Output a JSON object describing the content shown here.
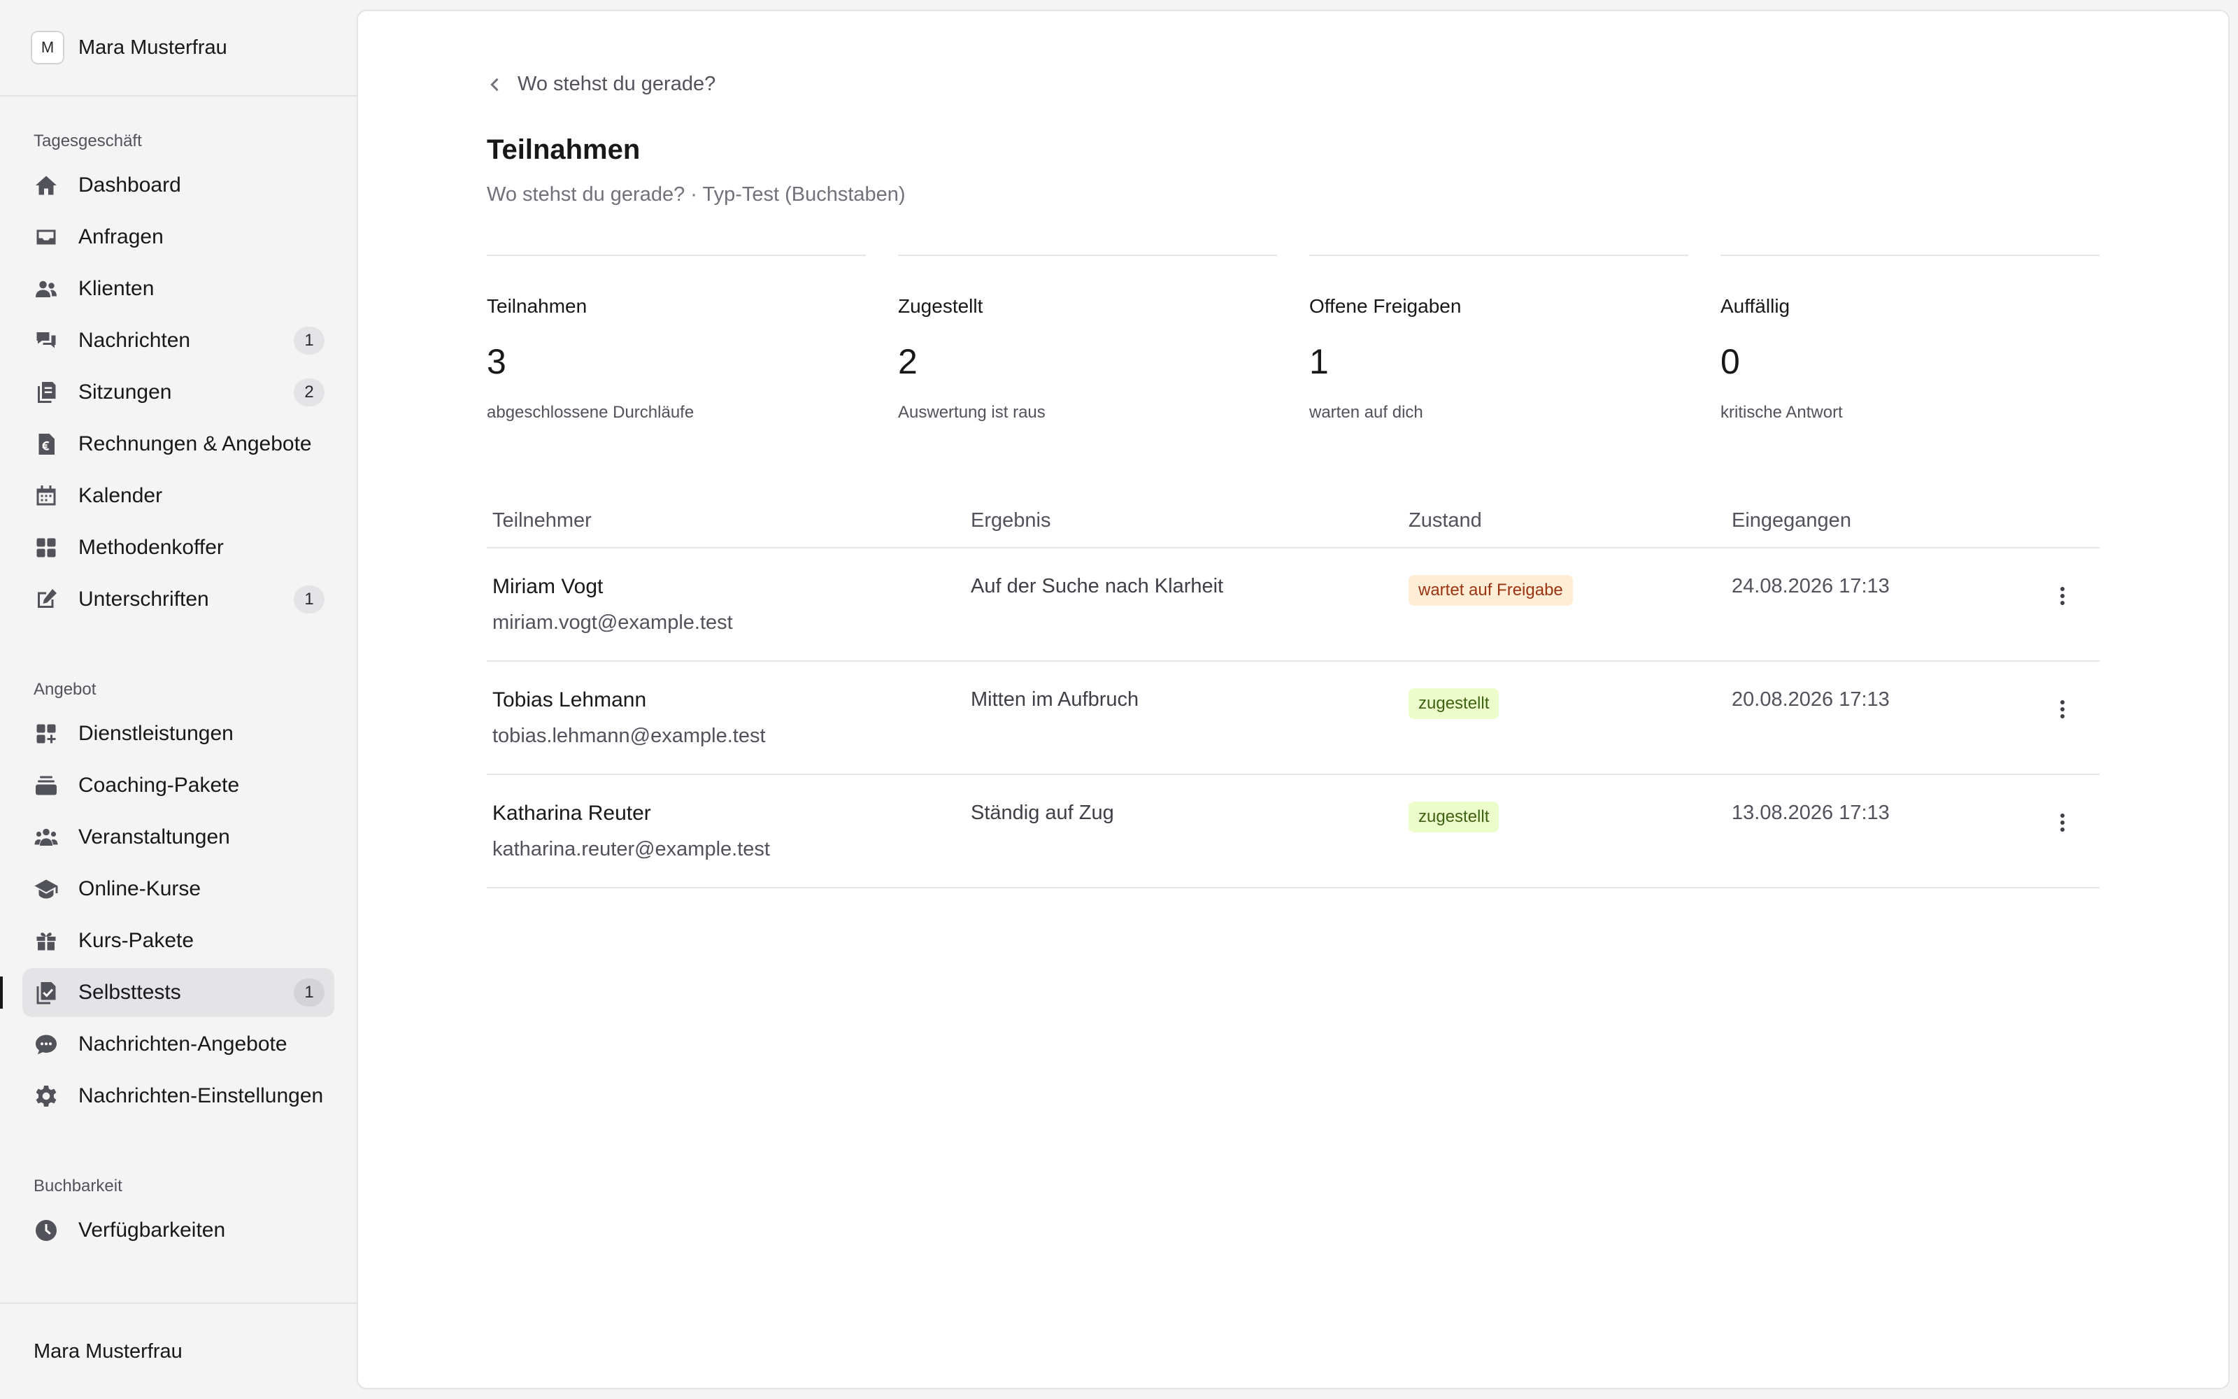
{
  "user": {
    "initial": "M",
    "name": "Mara Musterfrau"
  },
  "sidebar": {
    "sections": [
      {
        "label": "Tagesgeschäft",
        "items": [
          {
            "label": "Dashboard",
            "icon": "home-icon",
            "badge": ""
          },
          {
            "label": "Anfragen",
            "icon": "inbox-icon",
            "badge": ""
          },
          {
            "label": "Klienten",
            "icon": "users-icon",
            "badge": ""
          },
          {
            "label": "Nachrichten",
            "icon": "chat-icon",
            "badge": "1"
          },
          {
            "label": "Sitzungen",
            "icon": "documents-icon",
            "badge": "2"
          },
          {
            "label": "Rechnungen & Angebote",
            "icon": "invoice-euro-icon",
            "badge": ""
          },
          {
            "label": "Kalender",
            "icon": "calendar-icon",
            "badge": ""
          },
          {
            "label": "Methodenkoffer",
            "icon": "grid-icon",
            "badge": ""
          },
          {
            "label": "Unterschriften",
            "icon": "edit-icon",
            "badge": "1"
          }
        ]
      },
      {
        "label": "Angebot",
        "items": [
          {
            "label": "Dienstleistungen",
            "icon": "grid-plus-icon",
            "badge": ""
          },
          {
            "label": "Coaching-Pakete",
            "icon": "stack-icon",
            "badge": ""
          },
          {
            "label": "Veranstaltungen",
            "icon": "group-icon",
            "badge": ""
          },
          {
            "label": "Online-Kurse",
            "icon": "graduation-cap-icon",
            "badge": ""
          },
          {
            "label": "Kurs-Pakete",
            "icon": "gift-icon",
            "badge": ""
          },
          {
            "label": "Selbsttests",
            "icon": "checklist-icon",
            "badge": "1",
            "active": true
          },
          {
            "label": "Nachrichten-Angebote",
            "icon": "speech-bubble-icon",
            "badge": ""
          },
          {
            "label": "Nachrichten-Einstellungen",
            "icon": "gear-icon",
            "badge": ""
          }
        ]
      },
      {
        "label": "Buchbarkeit",
        "items": [
          {
            "label": "Verfügbarkeiten",
            "icon": "clock-icon",
            "badge": ""
          }
        ]
      }
    ]
  },
  "main": {
    "back_label": "Wo stehst du gerade?",
    "title": "Teilnahmen",
    "subtitle": "Wo stehst du gerade? · Typ-Test (Buchstaben)",
    "stats": [
      {
        "label": "Teilnahmen",
        "value": "3",
        "caption": "abgeschlossene Durchläufe"
      },
      {
        "label": "Zugestellt",
        "value": "2",
        "caption": "Auswertung ist raus"
      },
      {
        "label": "Offene Freigaben",
        "value": "1",
        "caption": "warten auf dich"
      },
      {
        "label": "Auffällig",
        "value": "0",
        "caption": "kritische Antwort"
      }
    ],
    "table": {
      "headers": [
        "Teilnehmer",
        "Ergebnis",
        "Zustand",
        "Eingegangen"
      ],
      "rows": [
        {
          "name": "Miriam Vogt",
          "email": "miriam.vogt@example.test",
          "result": "Auf der Suche nach Klarheit",
          "status": "wartet auf Freigabe",
          "status_type": "warn",
          "date": "24.08.2026 17:13"
        },
        {
          "name": "Tobias Lehmann",
          "email": "tobias.lehmann@example.test",
          "result": "Mitten im Aufbruch",
          "status": "zugestellt",
          "status_type": "ok",
          "date": "20.08.2026 17:13"
        },
        {
          "name": "Katharina Reuter",
          "email": "katharina.reuter@example.test",
          "result": "Ständig auf Zug",
          "status": "zugestellt",
          "status_type": "ok",
          "date": "13.08.2026 17:13"
        }
      ]
    }
  }
}
